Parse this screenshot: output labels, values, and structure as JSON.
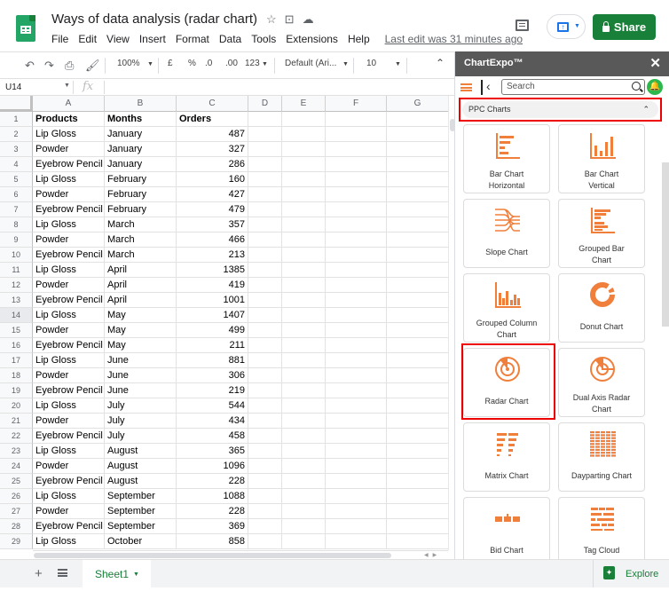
{
  "app": {
    "doc_title": "Ways of data analysis (radar chart)",
    "title_icons": [
      "star-icon",
      "move-to-folder-icon",
      "cloud-status-icon"
    ],
    "menu": [
      "File",
      "Edit",
      "View",
      "Insert",
      "Format",
      "Data",
      "Tools",
      "Extensions",
      "Help"
    ],
    "last_edit": "Last edit was 31 minutes ago",
    "share_label": "Share"
  },
  "toolbar": {
    "zoom": "100%",
    "currency": "£",
    "percent": "%",
    "decrease_decimal": ".0",
    "increase_decimal": ".00",
    "number_format": "123",
    "font": "Default (Ari...",
    "font_size": "10"
  },
  "formula_bar": {
    "name_box": "U14",
    "fx": "fx",
    "value": ""
  },
  "grid": {
    "columns": [
      "A",
      "B",
      "C",
      "D",
      "E",
      "F",
      "G"
    ],
    "header_row": [
      "Products",
      "Months",
      "Orders"
    ],
    "rows": [
      [
        "Lip Gloss",
        "January",
        "487"
      ],
      [
        "Powder",
        "January",
        "327"
      ],
      [
        "Eyebrow Pencil",
        "January",
        "286"
      ],
      [
        "Lip Gloss",
        "February",
        "160"
      ],
      [
        "Powder",
        "February",
        "427"
      ],
      [
        "Eyebrow Pencil",
        "February",
        "479"
      ],
      [
        "Lip Gloss",
        "March",
        "357"
      ],
      [
        "Powder",
        "March",
        "466"
      ],
      [
        "Eyebrow Pencil",
        "March",
        "213"
      ],
      [
        "Lip Gloss",
        "April",
        "1385"
      ],
      [
        "Powder",
        "April",
        "419"
      ],
      [
        "Eyebrow Pencil",
        "April",
        "1001"
      ],
      [
        "Lip Gloss",
        "May",
        "1407"
      ],
      [
        "Powder",
        "May",
        "499"
      ],
      [
        "Eyebrow Pencil",
        "May",
        "211"
      ],
      [
        "Lip Gloss",
        "June",
        "881"
      ],
      [
        "Powder",
        "June",
        "306"
      ],
      [
        "Eyebrow Pencil",
        "June",
        "219"
      ],
      [
        "Lip Gloss",
        "July",
        "544"
      ],
      [
        "Powder",
        "July",
        "434"
      ],
      [
        "Eyebrow Pencil",
        "July",
        "458"
      ],
      [
        "Lip Gloss",
        "August",
        "365"
      ],
      [
        "Powder",
        "August",
        "1096"
      ],
      [
        "Eyebrow Pencil",
        "August",
        "228"
      ],
      [
        "Lip Gloss",
        "September",
        "1088"
      ],
      [
        "Powder",
        "September",
        "228"
      ],
      [
        "Eyebrow Pencil",
        "September",
        "369"
      ],
      [
        "Lip Gloss",
        "October",
        "858"
      ]
    ],
    "selected_row": 14
  },
  "sheets": {
    "tabs": [
      "Sheet1"
    ],
    "explore_label": "Explore"
  },
  "panel": {
    "title": "ChartExpo™",
    "search_placeholder": "Search",
    "category": "PPC Charts",
    "accent_color": "#f07f3c",
    "charts": [
      {
        "label": "Bar Chart Horizontal",
        "lines": [
          "Bar Chart",
          "Horizontal"
        ],
        "icon": "bar-chart-horizontal-icon"
      },
      {
        "label": "Bar Chart Vertical",
        "lines": [
          "Bar Chart",
          "Vertical"
        ],
        "icon": "bar-chart-vertical-icon"
      },
      {
        "label": "Slope Chart",
        "lines": [
          "Slope Chart"
        ],
        "icon": "slope-chart-icon"
      },
      {
        "label": "Grouped Bar Chart",
        "lines": [
          "Grouped Bar",
          "Chart"
        ],
        "icon": "grouped-bar-chart-icon"
      },
      {
        "label": "Grouped Column Chart",
        "lines": [
          "Grouped Column",
          "Chart"
        ],
        "icon": "grouped-column-chart-icon"
      },
      {
        "label": "Donut Chart",
        "lines": [
          "Donut Chart"
        ],
        "icon": "donut-chart-icon"
      },
      {
        "label": "Radar Chart",
        "lines": [
          "Radar Chart"
        ],
        "icon": "radar-chart-icon"
      },
      {
        "label": "Dual Axis Radar Chart",
        "lines": [
          "Dual Axis Radar",
          "Chart"
        ],
        "icon": "dual-axis-radar-chart-icon"
      },
      {
        "label": "Matrix Chart",
        "lines": [
          "Matrix Chart"
        ],
        "icon": "matrix-chart-icon"
      },
      {
        "label": "Dayparting Chart",
        "lines": [
          "Dayparting Chart"
        ],
        "icon": "dayparting-chart-icon"
      },
      {
        "label": "Bid Chart",
        "lines": [
          "Bid Chart"
        ],
        "icon": "bid-chart-icon"
      },
      {
        "label": "Tag Cloud",
        "lines": [
          "Tag Cloud"
        ],
        "icon": "tag-cloud-icon"
      }
    ]
  }
}
